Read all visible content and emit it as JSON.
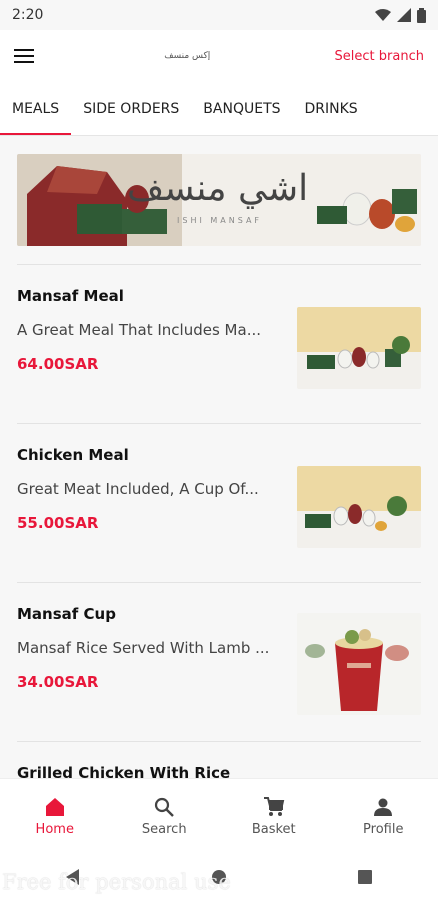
{
  "status": {
    "time": "2:20"
  },
  "header": {
    "logo_text": "إكس منسف",
    "branch_label": "Select branch"
  },
  "tabs": [
    {
      "label": "MEALS",
      "active": true
    },
    {
      "label": "SIDE ORDERS",
      "active": false
    },
    {
      "label": "BANQUETS",
      "active": false
    },
    {
      "label": "DRINKS",
      "active": false
    }
  ],
  "banner": {
    "brand_text": "اشي منسف",
    "sub_text": "ISHI MANSAF"
  },
  "items": [
    {
      "name": "Mansaf Meal",
      "description": "A Great Meal That Includes Ma...",
      "price": "64.00SAR"
    },
    {
      "name": "Chicken Meal",
      "description": "Great Meat Included, A Cup Of...",
      "price": "55.00SAR"
    },
    {
      "name": "Mansaf Cup",
      "description": "Mansaf Rice Served With Lamb ...",
      "price": "34.00SAR"
    },
    {
      "name": "Grilled Chicken With Rice"
    }
  ],
  "bottom_nav": [
    {
      "label": "Home",
      "icon": "home-icon",
      "active": true
    },
    {
      "label": "Search",
      "icon": "search-icon",
      "active": false
    },
    {
      "label": "Basket",
      "icon": "cart-icon",
      "active": false
    },
    {
      "label": "Profile",
      "icon": "profile-icon",
      "active": false
    }
  ],
  "watermark": "Free for personal use",
  "colors": {
    "accent": "#e8173a",
    "background": "#f7f7f7"
  }
}
